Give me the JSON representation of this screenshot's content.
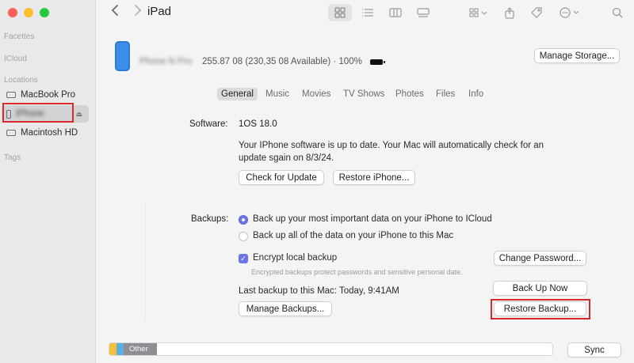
{
  "sidebar": {
    "favorites_heading": "Facettes",
    "icloud_heading": "ICloud",
    "locations_heading": "Locations",
    "tags_heading": "Tags",
    "items": [
      {
        "label": "MacBook Pro",
        "icon": "disk-icon"
      },
      {
        "label": "iPhone",
        "icon": "phone-icon",
        "selected": true
      },
      {
        "label": "Macintosh HD",
        "icon": "disk-icon"
      }
    ]
  },
  "toolbar": {
    "title": "iPad",
    "back_icon": "chevron-left-icon",
    "forward_icon": "chevron-right-icon"
  },
  "device": {
    "name": "Phone N Pro",
    "info": "255.87 08 (230,35 08 Available) · 100%",
    "manage_storage_label": "Manage Storage..."
  },
  "tabs": [
    "General",
    "Music",
    "Movies",
    "TV Shows",
    "Photes",
    "Files",
    "Info"
  ],
  "software": {
    "label": "Software:",
    "version": "1OS 18.0",
    "status_line1": "Your IPhone software is up to date. Your Mac will automatically check for an",
    "status_line2": "update sgain on 8/3/24.",
    "check_update_label": "Check for Update",
    "restore_iphone_label": "Restore iPhone..."
  },
  "backups": {
    "label": "Backups:",
    "option_icloud": "Back up your most important data on your iPhone to ICloud",
    "option_mac": "Back up all of the data on your iPhone to this Mac",
    "selected_option": "icloud",
    "encrypt_label": "Encrypt local backup",
    "encrypt_checked": true,
    "encrypt_note": "Encrypted backups protect passwords and sensitive personal date.",
    "change_password_label": "Change Password...",
    "last_backup": "Last backup to this Mac:  Today, 9:41AM",
    "back_up_now_label": "Back Up Now",
    "manage_backups_label": "Manage Backups...",
    "restore_backup_label": "Restore Backup..."
  },
  "storage_bar": {
    "other_label": "Other",
    "sync_label": "Sync",
    "colors": {
      "yellow": "#f2c13b",
      "blue": "#5ab0e3",
      "other": "#8e8e93"
    }
  },
  "accent": "#6a74e8",
  "highlight_color": "#d92b2b"
}
